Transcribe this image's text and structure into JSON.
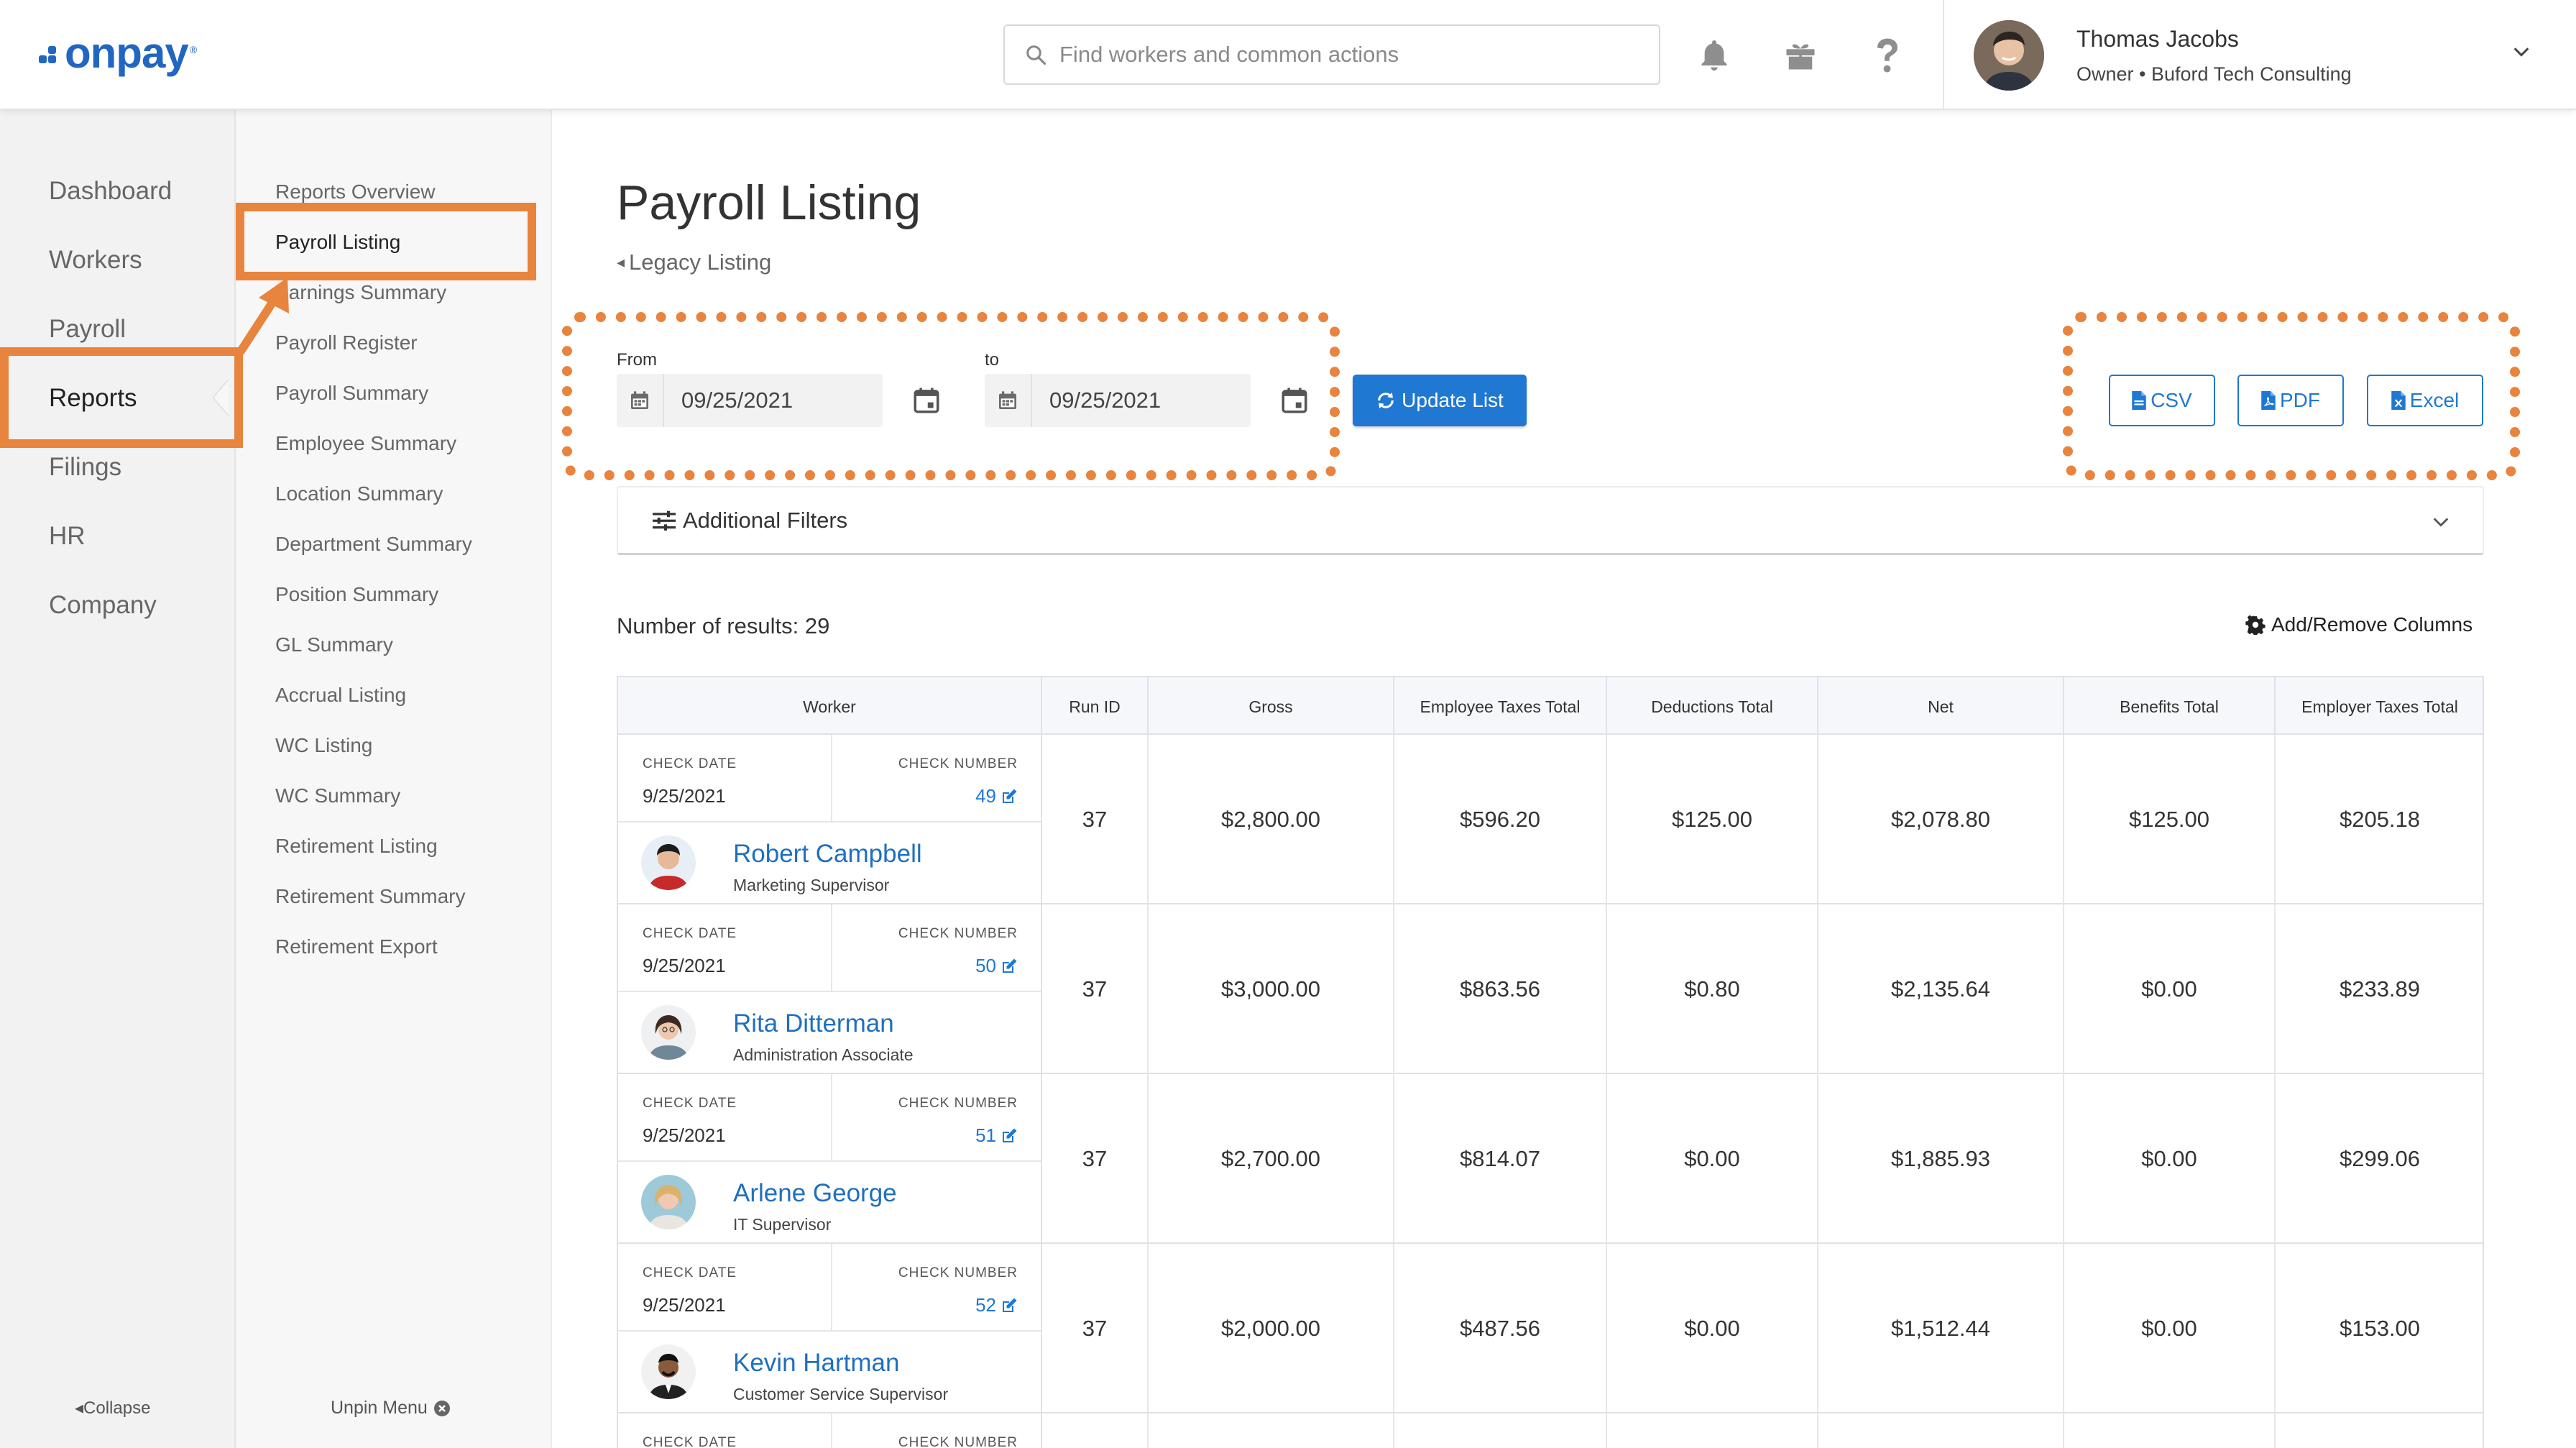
{
  "app": {
    "logo_text": "onpay",
    "logo_mark": "®",
    "brand_color": "#2166c1",
    "accent_color": "#e8843e"
  },
  "header": {
    "search_placeholder": "Find workers and common actions",
    "icons": [
      "bell-icon",
      "gift-icon",
      "help-icon"
    ],
    "user": {
      "name": "Thomas Jacobs",
      "role": "Owner • Buford Tech Consulting"
    }
  },
  "leftnav": {
    "items": [
      {
        "label": "Dashboard"
      },
      {
        "label": "Workers"
      },
      {
        "label": "Payroll"
      },
      {
        "label": "Reports",
        "active": true
      },
      {
        "label": "Filings"
      },
      {
        "label": "HR"
      },
      {
        "label": "Company"
      }
    ],
    "collapse_label": "Collapse"
  },
  "subnav": {
    "items": [
      {
        "label": "Reports Overview"
      },
      {
        "label": "Payroll Listing",
        "active": true
      },
      {
        "label": "Earnings Summary"
      },
      {
        "label": "Payroll Register"
      },
      {
        "label": "Payroll Summary"
      },
      {
        "label": "Employee Summary"
      },
      {
        "label": "Location Summary"
      },
      {
        "label": "Department Summary"
      },
      {
        "label": "Position Summary"
      },
      {
        "label": "GL Summary"
      },
      {
        "label": "Accrual Listing"
      },
      {
        "label": "WC Listing"
      },
      {
        "label": "WC Summary"
      },
      {
        "label": "Retirement Listing"
      },
      {
        "label": "Retirement Summary"
      },
      {
        "label": "Retirement Export"
      }
    ],
    "unpin_label": "Unpin Menu"
  },
  "main": {
    "title": "Payroll Listing",
    "legacy_link": "Legacy Listing",
    "from_label": "From",
    "to_label": "to",
    "from_value": "09/25/2021",
    "to_value": "09/25/2021",
    "update_button": "Update List",
    "export_buttons": {
      "csv": "CSV",
      "pdf": "PDF",
      "excel": "Excel"
    },
    "filters_label": "Additional Filters",
    "results_text": "Number of results: 29",
    "add_remove_columns": "Add/Remove Columns"
  },
  "table": {
    "headers": [
      "Worker",
      "Run ID",
      "Gross",
      "Employee Taxes Total",
      "Deductions Total",
      "Net",
      "Benefits Total",
      "Employer Taxes Total"
    ],
    "check_date_label": "CHECK DATE",
    "check_number_label": "CHECK NUMBER",
    "rows": [
      {
        "check_date": "9/25/2021",
        "check_number": "49",
        "name": "Robert Campbell",
        "title": "Marketing Supervisor",
        "run_id": "37",
        "gross": "$2,800.00",
        "emp_taxes": "$596.20",
        "deductions": "$125.00",
        "net": "$2,078.80",
        "benefits": "$125.00",
        "employer_taxes": "$205.18"
      },
      {
        "check_date": "9/25/2021",
        "check_number": "50",
        "name": "Rita Ditterman",
        "title": "Administration Associate",
        "run_id": "37",
        "gross": "$3,000.00",
        "emp_taxes": "$863.56",
        "deductions": "$0.80",
        "net": "$2,135.64",
        "benefits": "$0.00",
        "employer_taxes": "$233.89"
      },
      {
        "check_date": "9/25/2021",
        "check_number": "51",
        "name": "Arlene George",
        "title": "IT Supervisor",
        "run_id": "37",
        "gross": "$2,700.00",
        "emp_taxes": "$814.07",
        "deductions": "$0.00",
        "net": "$1,885.93",
        "benefits": "$0.00",
        "employer_taxes": "$299.06"
      },
      {
        "check_date": "9/25/2021",
        "check_number": "52",
        "name": "Kevin Hartman",
        "title": "Customer Service Supervisor",
        "run_id": "37",
        "gross": "$2,000.00",
        "emp_taxes": "$487.56",
        "deductions": "$0.00",
        "net": "$1,512.44",
        "benefits": "$0.00",
        "employer_taxes": "$153.00"
      }
    ]
  }
}
